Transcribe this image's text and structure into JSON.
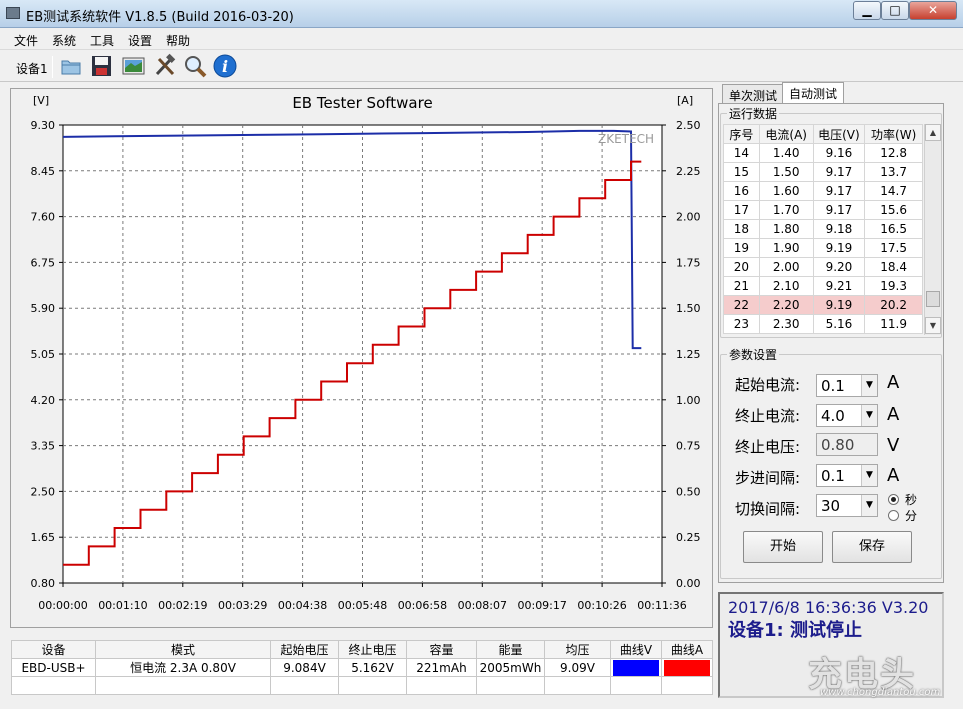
{
  "window": {
    "title": "EB测试系统软件 V1.8.5 (Build 2016-03-20)",
    "minimize": "▁",
    "maximize": "□",
    "close": "✕"
  },
  "menu": [
    "文件",
    "系统",
    "工具",
    "设置",
    "帮助"
  ],
  "toolbar": {
    "device_label": "设备1",
    "icons": [
      "folder-icon",
      "save-icon",
      "image-icon",
      "tools-icon",
      "search-icon",
      "info-icon"
    ]
  },
  "tabs": [
    "单次测试",
    "自动测试"
  ],
  "run_data": {
    "group_label": "运行数据",
    "columns": [
      "序号",
      "电流(A)",
      "电压(V)",
      "功率(W)"
    ],
    "rows": [
      [
        "14",
        "1.40",
        "9.16",
        "12.8"
      ],
      [
        "15",
        "1.50",
        "9.17",
        "13.7"
      ],
      [
        "16",
        "1.60",
        "9.17",
        "14.7"
      ],
      [
        "17",
        "1.70",
        "9.17",
        "15.6"
      ],
      [
        "18",
        "1.80",
        "9.18",
        "16.5"
      ],
      [
        "19",
        "1.90",
        "9.19",
        "17.5"
      ],
      [
        "20",
        "2.00",
        "9.20",
        "18.4"
      ],
      [
        "21",
        "2.10",
        "9.21",
        "19.3"
      ],
      [
        "22",
        "2.20",
        "9.19",
        "20.2"
      ],
      [
        "23",
        "2.30",
        "5.16",
        "11.9"
      ]
    ],
    "selected_row": "22"
  },
  "params": {
    "group_label": "参数设置",
    "start_current": {
      "label": "起始电流:",
      "value": "0.1",
      "unit": "A"
    },
    "stop_current": {
      "label": "终止电流:",
      "value": "4.0",
      "unit": "A"
    },
    "stop_voltage": {
      "label": "终止电压:",
      "value": "0.80",
      "unit": "V"
    },
    "step": {
      "label": "步进间隔:",
      "value": "0.1",
      "unit": "A"
    },
    "switch_interval": {
      "label": "切换间隔:",
      "value": "30"
    },
    "unit_seconds": "秒",
    "unit_minutes": "分",
    "unit_selected": "秒",
    "start_button": "开始",
    "save_button": "保存"
  },
  "status": {
    "line1": "2017/6/8 16:36:36  V3.20",
    "line2": "设备1: 测试停止"
  },
  "summary": {
    "headers": [
      "设备",
      "模式",
      "起始电压",
      "终止电压",
      "容量",
      "能量",
      "均压",
      "曲线V",
      "曲线A"
    ],
    "row": [
      "EBD-USB+",
      "恒电流  2.3A  0.80V",
      "9.084V",
      "5.162V",
      "221mAh",
      "2005mWh",
      "9.09V"
    ],
    "curve_v_color": "#0000ff",
    "curve_a_color": "#ff0000"
  },
  "watermark": {
    "text": "充电头",
    "url": "www.chongdiantou.com"
  },
  "chart_data": {
    "type": "line",
    "title": "EB Tester Software",
    "watermark": "ZKETECH",
    "left_unit": "[V]",
    "right_unit": "[A]",
    "y_left_lim": [
      0.8,
      9.3
    ],
    "y_right_lim": [
      0.0,
      2.5
    ],
    "y_left_ticks": [
      "9.30",
      "8.45",
      "7.60",
      "6.75",
      "5.90",
      "5.05",
      "4.20",
      "3.35",
      "2.50",
      "1.65",
      "0.80"
    ],
    "y_right_ticks": [
      "2.50",
      "2.25",
      "2.00",
      "1.75",
      "1.50",
      "1.25",
      "1.00",
      "0.75",
      "0.50",
      "0.25",
      "0.00"
    ],
    "x_lim_seconds": [
      0,
      696
    ],
    "x_ticks": [
      "00:00:00",
      "00:01:10",
      "00:02:19",
      "00:03:29",
      "00:04:38",
      "00:05:48",
      "00:06:58",
      "00:08:07",
      "00:09:17",
      "00:10:26",
      "00:11:36"
    ],
    "grid": true,
    "series": [
      {
        "name": "曲线V",
        "axis": "left",
        "color": "#1c2ea8",
        "points": [
          [
            0,
            9.08
          ],
          [
            60,
            9.09
          ],
          [
            120,
            9.1
          ],
          [
            180,
            9.11
          ],
          [
            240,
            9.12
          ],
          [
            300,
            9.13
          ],
          [
            360,
            9.14
          ],
          [
            420,
            9.15
          ],
          [
            480,
            9.16
          ],
          [
            540,
            9.17
          ],
          [
            600,
            9.19
          ],
          [
            640,
            9.19
          ],
          [
            660,
            9.18
          ],
          [
            662,
            5.16
          ],
          [
            672,
            5.16
          ]
        ]
      },
      {
        "name": "曲线A",
        "axis": "right",
        "color": "#cc0000",
        "step_currents": [
          0.1,
          0.2,
          0.3,
          0.4,
          0.5,
          0.6,
          0.7,
          0.8,
          0.9,
          1.0,
          1.1,
          1.2,
          1.3,
          1.4,
          1.5,
          1.6,
          1.7,
          1.8,
          1.9,
          2.0,
          2.1,
          2.2,
          2.3
        ],
        "step_seconds": 30
      }
    ]
  }
}
